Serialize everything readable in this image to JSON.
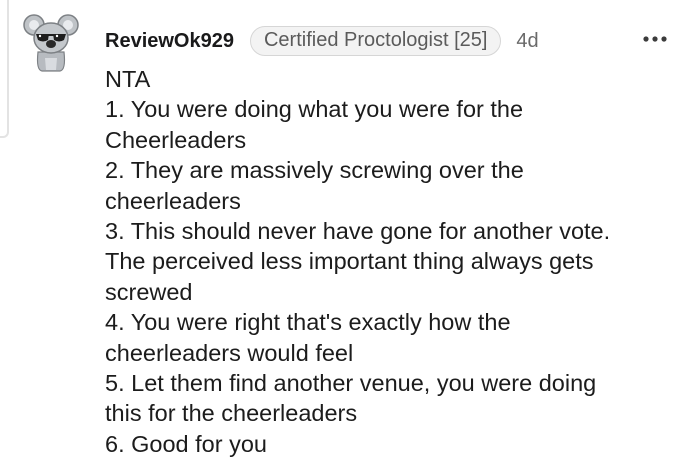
{
  "comment": {
    "author": "ReviewOk929",
    "flair": "Certified Proctologist [25]",
    "age": "4d",
    "avatar_icon": "koala-avatar-icon",
    "more_icon": "more-options-icon",
    "lines": [
      "NTA",
      "1. You were doing what you were for the",
      "Cheerleaders",
      "2. They are massively screwing over the",
      "cheerleaders",
      "3. This should never have gone for another vote.",
      "The perceived less important thing always gets",
      "screwed",
      "4. You were right that's exactly how the",
      "cheerleaders would feel",
      "5. Let them find another venue, you were doing",
      "this for the cheerleaders",
      "6. Good for you"
    ]
  }
}
